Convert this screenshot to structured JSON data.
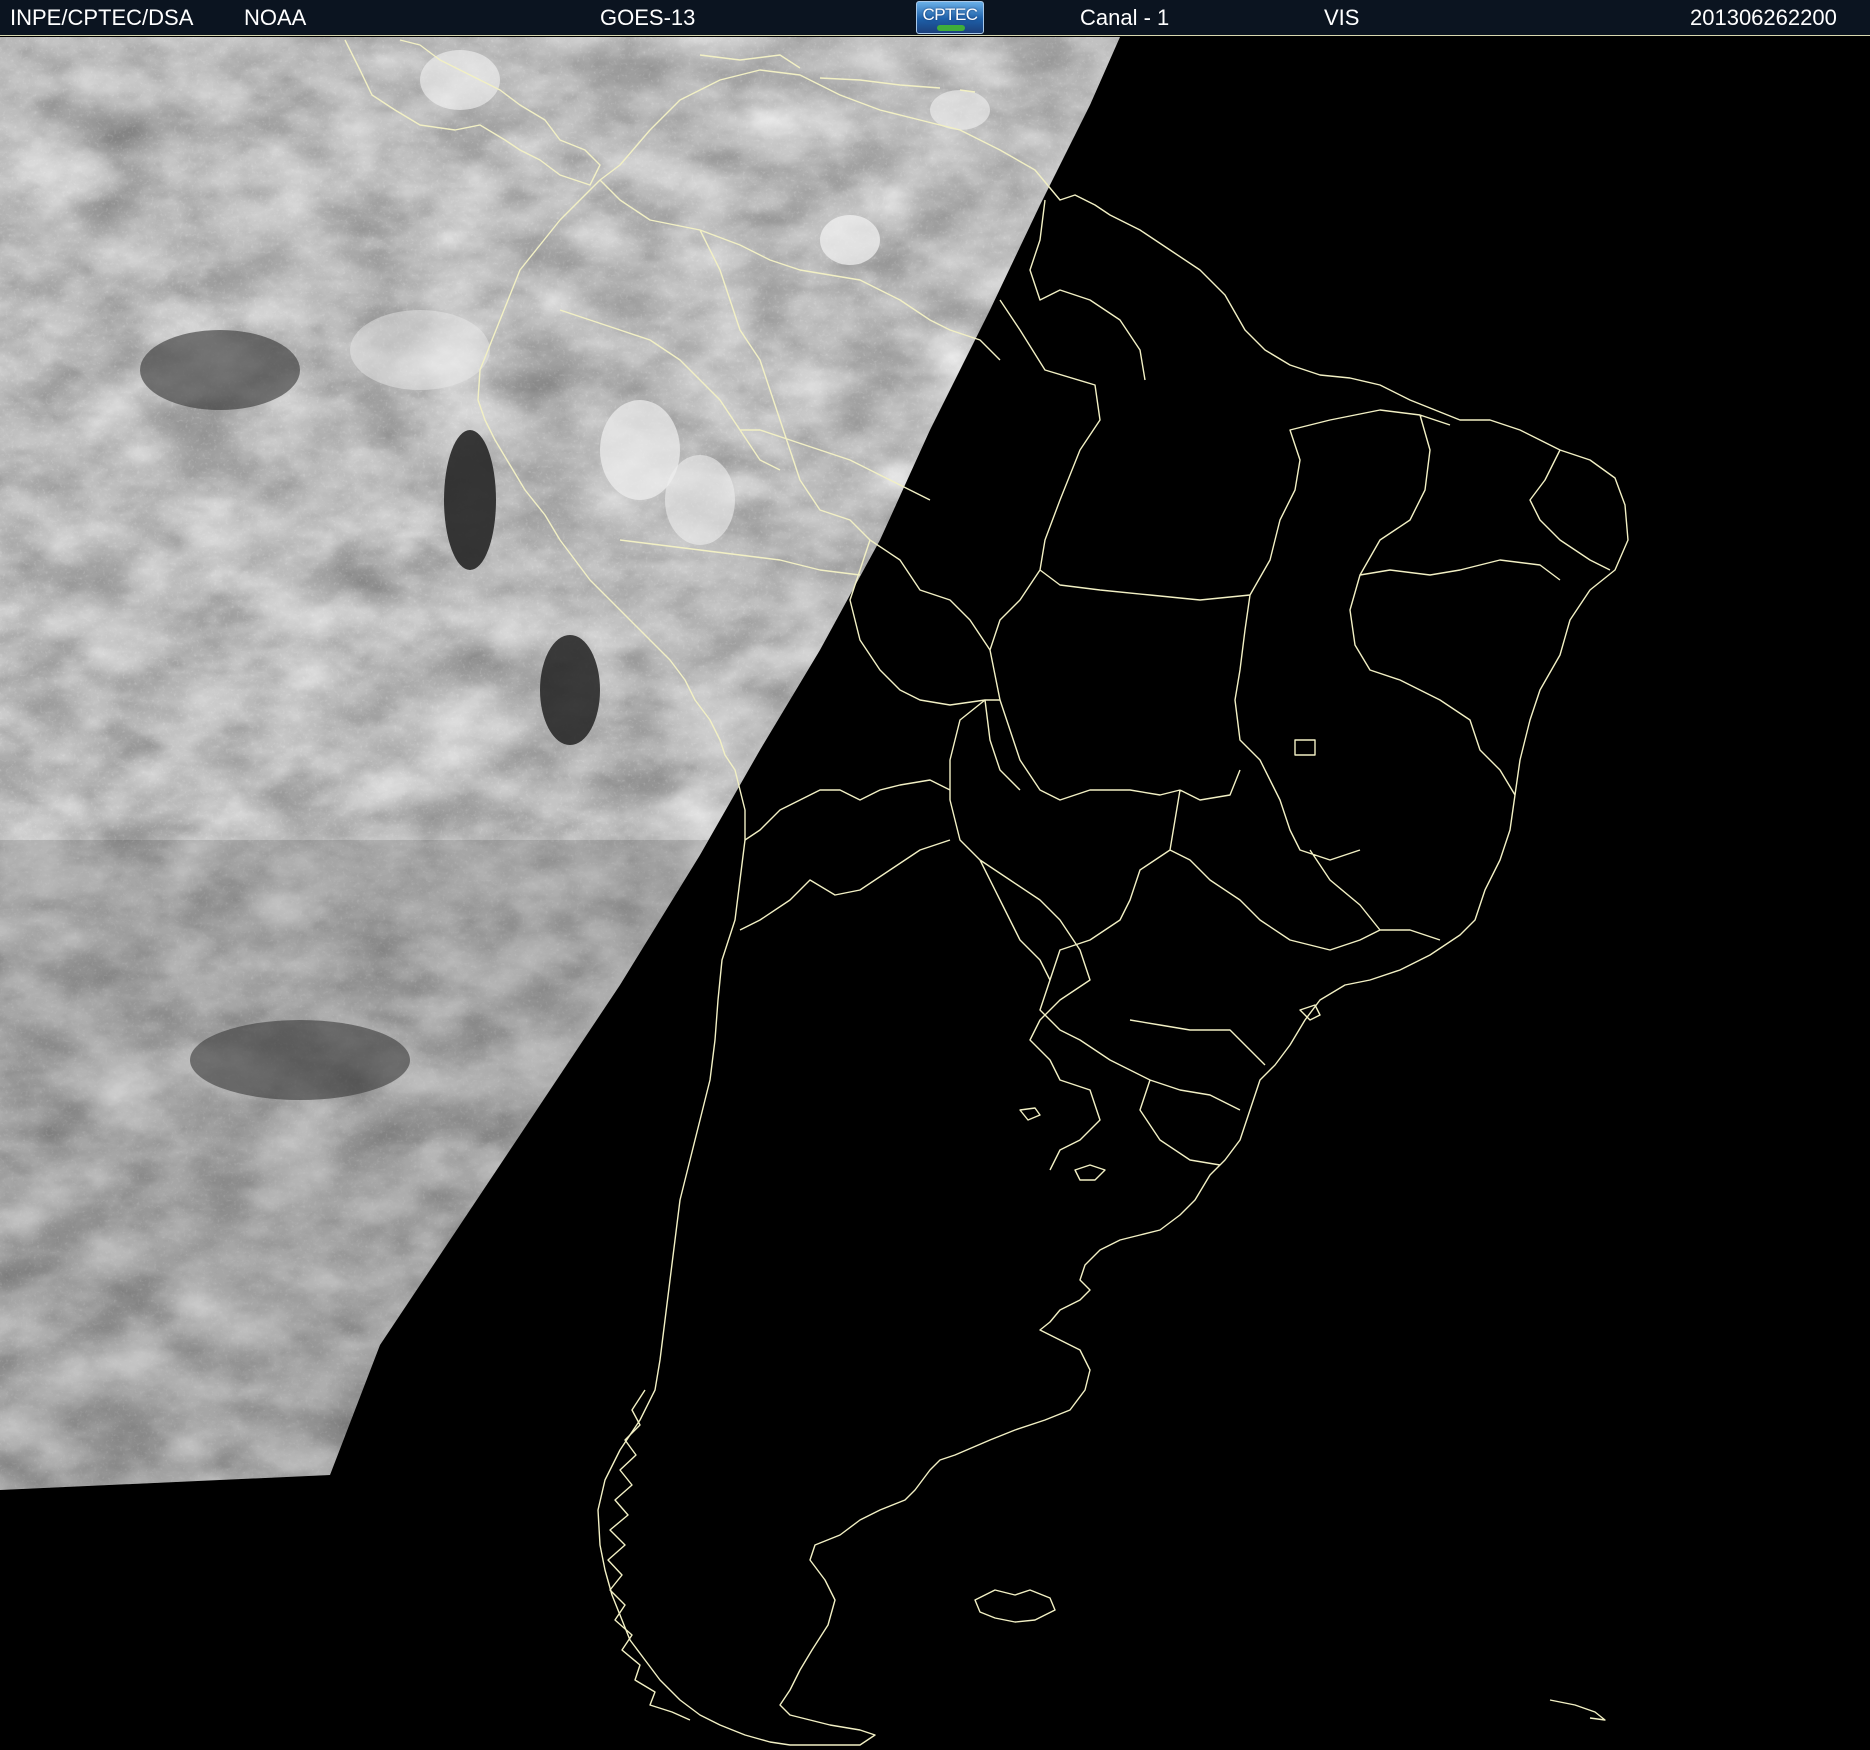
{
  "header": {
    "agency": "INPE/CPTEC/DSA",
    "provider": "NOAA",
    "satellite": "GOES-13",
    "logo_text": "CPTEC",
    "channel": "Canal - 1",
    "band": "VIS",
    "timestamp": "201306262200"
  },
  "colors": {
    "header_background": "#0b1420",
    "header_text": "#ffffff",
    "boundary_lines": "#f2f0c4",
    "night_side": "#000000",
    "cloud_bright": "#e6e6e6",
    "ocean_dark": "#3c3c3c"
  }
}
